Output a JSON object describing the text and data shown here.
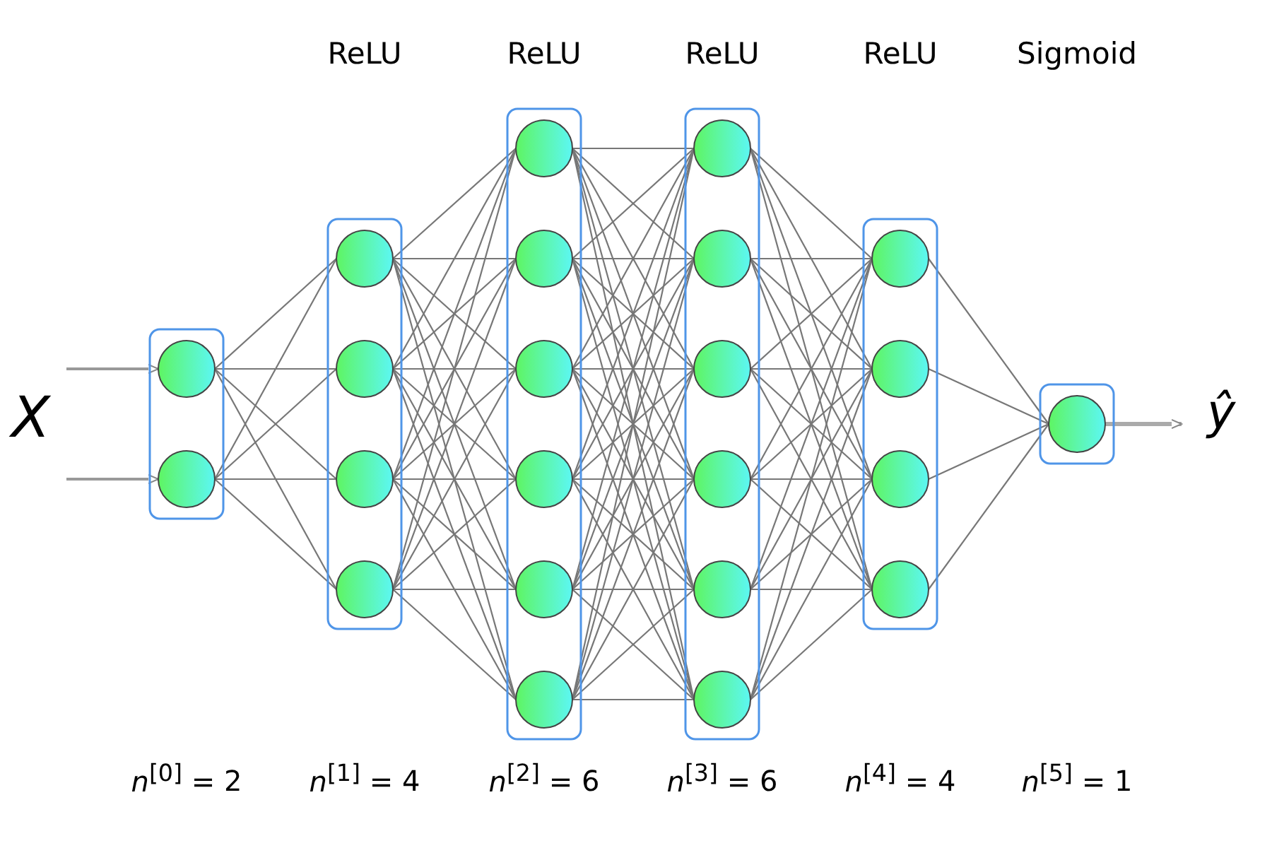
{
  "input_label": "X",
  "output_label": "ŷ",
  "layers": [
    {
      "size_label": "*n*$^{[0]}$ =",
      "neurons": "2"
    },
    {
      "activation": "ReLU",
      "size_label": "*n*$^{[1]}$ =",
      "neurons": "4"
    },
    {
      "activation": "ReLU",
      "size_label": "*n*$^{[2]}$ =",
      "neurons": "6"
    },
    {
      "activation": "ReLU",
      "size_label": "*n*$^{[3]}$ =",
      "neurons": "6"
    },
    {
      "activation": "ReLU",
      "size_label": "*n*$^{[4]}$ =",
      "neurons": "4"
    },
    {
      "activation": "Sigmoid",
      "size_label": "*n*$^{[5]}$ =",
      "neurons": "1"
    }
  ]
}
